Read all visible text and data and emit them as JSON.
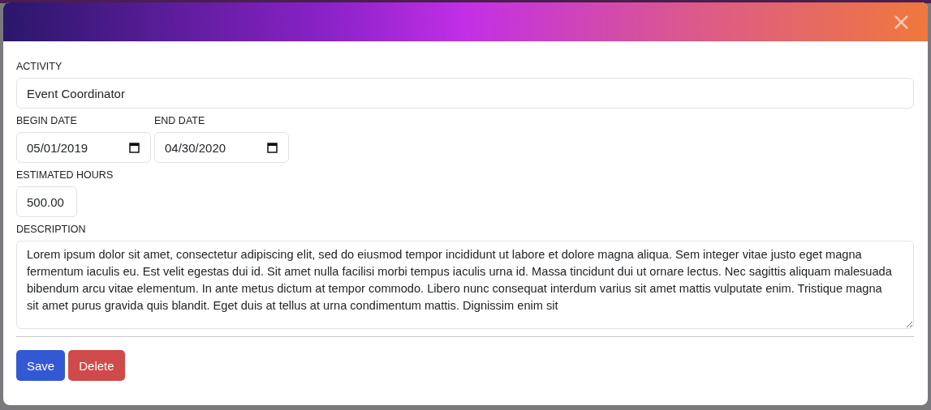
{
  "modal": {
    "close": "×"
  },
  "fields": [
    {
      "kind": "text",
      "label": "ACTIVITY",
      "value": "Event Coordinator"
    },
    {
      "kind": "date",
      "label": "BEGIN DATE",
      "value": "05/01/2019"
    },
    {
      "kind": "date",
      "label": "END DATE",
      "value": "04/30/2020"
    },
    {
      "kind": "number",
      "label": "ESTIMATED HOURS",
      "value": "500.00"
    },
    {
      "kind": "textarea",
      "label": "DESCRIPTION",
      "value": "Lorem ipsum dolor sit amet, consectetur adipiscing elit, sed do eiusmod tempor incididunt ut labore et dolore magna aliqua. Sem integer vitae justo eget magna fermentum iaculis eu. Est velit egestas dui id. Sit amet nulla facilisi morbi tempus iaculis urna id. Massa tincidunt dui ut ornare lectus. Nec sagittis aliquam malesuada bibendum arcu vitae elementum. In ante metus dictum at tempor commodo. Libero nunc consequat interdum varius sit amet mattis vulputate enim. Tristique magna sit amet purus gravida quis blandit. Eget duis at tellus at urna condimentum mattis. Dignissim enim sit"
    }
  ],
  "buttons": [
    {
      "kind": "primary",
      "label": "Save"
    },
    {
      "kind": "danger",
      "label": "Delete"
    }
  ]
}
